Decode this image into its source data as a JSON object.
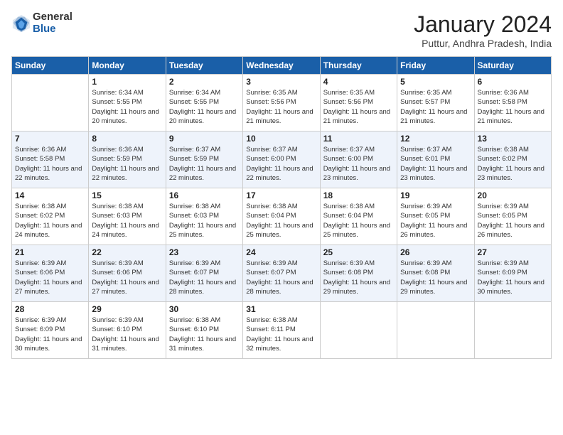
{
  "header": {
    "logo_general": "General",
    "logo_blue": "Blue",
    "title": "January 2024",
    "subtitle": "Puttur, Andhra Pradesh, India"
  },
  "days_of_week": [
    "Sunday",
    "Monday",
    "Tuesday",
    "Wednesday",
    "Thursday",
    "Friday",
    "Saturday"
  ],
  "weeks": [
    [
      {
        "day": "",
        "info": ""
      },
      {
        "day": "1",
        "info": "Sunrise: 6:34 AM\nSunset: 5:55 PM\nDaylight: 11 hours and 20 minutes."
      },
      {
        "day": "2",
        "info": "Sunrise: 6:34 AM\nSunset: 5:55 PM\nDaylight: 11 hours and 20 minutes."
      },
      {
        "day": "3",
        "info": "Sunrise: 6:35 AM\nSunset: 5:56 PM\nDaylight: 11 hours and 21 minutes."
      },
      {
        "day": "4",
        "info": "Sunrise: 6:35 AM\nSunset: 5:56 PM\nDaylight: 11 hours and 21 minutes."
      },
      {
        "day": "5",
        "info": "Sunrise: 6:35 AM\nSunset: 5:57 PM\nDaylight: 11 hours and 21 minutes."
      },
      {
        "day": "6",
        "info": "Sunrise: 6:36 AM\nSunset: 5:58 PM\nDaylight: 11 hours and 21 minutes."
      }
    ],
    [
      {
        "day": "7",
        "info": "Sunrise: 6:36 AM\nSunset: 5:58 PM\nDaylight: 11 hours and 22 minutes."
      },
      {
        "day": "8",
        "info": "Sunrise: 6:36 AM\nSunset: 5:59 PM\nDaylight: 11 hours and 22 minutes."
      },
      {
        "day": "9",
        "info": "Sunrise: 6:37 AM\nSunset: 5:59 PM\nDaylight: 11 hours and 22 minutes."
      },
      {
        "day": "10",
        "info": "Sunrise: 6:37 AM\nSunset: 6:00 PM\nDaylight: 11 hours and 22 minutes."
      },
      {
        "day": "11",
        "info": "Sunrise: 6:37 AM\nSunset: 6:00 PM\nDaylight: 11 hours and 23 minutes."
      },
      {
        "day": "12",
        "info": "Sunrise: 6:37 AM\nSunset: 6:01 PM\nDaylight: 11 hours and 23 minutes."
      },
      {
        "day": "13",
        "info": "Sunrise: 6:38 AM\nSunset: 6:02 PM\nDaylight: 11 hours and 23 minutes."
      }
    ],
    [
      {
        "day": "14",
        "info": "Sunrise: 6:38 AM\nSunset: 6:02 PM\nDaylight: 11 hours and 24 minutes."
      },
      {
        "day": "15",
        "info": "Sunrise: 6:38 AM\nSunset: 6:03 PM\nDaylight: 11 hours and 24 minutes."
      },
      {
        "day": "16",
        "info": "Sunrise: 6:38 AM\nSunset: 6:03 PM\nDaylight: 11 hours and 25 minutes."
      },
      {
        "day": "17",
        "info": "Sunrise: 6:38 AM\nSunset: 6:04 PM\nDaylight: 11 hours and 25 minutes."
      },
      {
        "day": "18",
        "info": "Sunrise: 6:38 AM\nSunset: 6:04 PM\nDaylight: 11 hours and 25 minutes."
      },
      {
        "day": "19",
        "info": "Sunrise: 6:39 AM\nSunset: 6:05 PM\nDaylight: 11 hours and 26 minutes."
      },
      {
        "day": "20",
        "info": "Sunrise: 6:39 AM\nSunset: 6:05 PM\nDaylight: 11 hours and 26 minutes."
      }
    ],
    [
      {
        "day": "21",
        "info": "Sunrise: 6:39 AM\nSunset: 6:06 PM\nDaylight: 11 hours and 27 minutes."
      },
      {
        "day": "22",
        "info": "Sunrise: 6:39 AM\nSunset: 6:06 PM\nDaylight: 11 hours and 27 minutes."
      },
      {
        "day": "23",
        "info": "Sunrise: 6:39 AM\nSunset: 6:07 PM\nDaylight: 11 hours and 28 minutes."
      },
      {
        "day": "24",
        "info": "Sunrise: 6:39 AM\nSunset: 6:07 PM\nDaylight: 11 hours and 28 minutes."
      },
      {
        "day": "25",
        "info": "Sunrise: 6:39 AM\nSunset: 6:08 PM\nDaylight: 11 hours and 29 minutes."
      },
      {
        "day": "26",
        "info": "Sunrise: 6:39 AM\nSunset: 6:08 PM\nDaylight: 11 hours and 29 minutes."
      },
      {
        "day": "27",
        "info": "Sunrise: 6:39 AM\nSunset: 6:09 PM\nDaylight: 11 hours and 30 minutes."
      }
    ],
    [
      {
        "day": "28",
        "info": "Sunrise: 6:39 AM\nSunset: 6:09 PM\nDaylight: 11 hours and 30 minutes."
      },
      {
        "day": "29",
        "info": "Sunrise: 6:39 AM\nSunset: 6:10 PM\nDaylight: 11 hours and 31 minutes."
      },
      {
        "day": "30",
        "info": "Sunrise: 6:38 AM\nSunset: 6:10 PM\nDaylight: 11 hours and 31 minutes."
      },
      {
        "day": "31",
        "info": "Sunrise: 6:38 AM\nSunset: 6:11 PM\nDaylight: 11 hours and 32 minutes."
      },
      {
        "day": "",
        "info": ""
      },
      {
        "day": "",
        "info": ""
      },
      {
        "day": "",
        "info": ""
      }
    ]
  ]
}
